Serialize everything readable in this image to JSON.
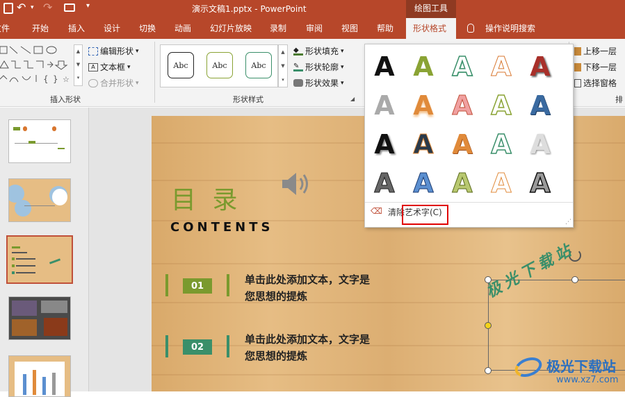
{
  "titlebar": {
    "title": "演示文稿1.pptx - PowerPoint",
    "context_tab": "绘图工具"
  },
  "tabs": [
    "文件",
    "开始",
    "插入",
    "设计",
    "切换",
    "动画",
    "幻灯片放映",
    "录制",
    "审阅",
    "视图",
    "帮助",
    "形状格式"
  ],
  "tell_me": "操作说明搜索",
  "ribbon": {
    "insert_shapes": {
      "edit_shape": "编辑形状",
      "text_box": "文本框",
      "merge_shapes": "合并形状",
      "label": "插入形状"
    },
    "shape_styles": {
      "style_sample": "Abc",
      "fill": "形状填充",
      "outline": "形状轮廓",
      "effects": "形状效果",
      "label": "形状样式"
    },
    "arrange": {
      "bring_forward": "上移一层",
      "send_backward": "下移一层",
      "selection_pane": "选择窗格",
      "label_partial": "排"
    }
  },
  "wordart_gallery": {
    "glyph": "A",
    "clear_label": "清除艺术字(C)"
  },
  "slide": {
    "title": "目 录",
    "subtitle": "CONTENTS",
    "items": [
      {
        "num": "01",
        "line1": "单击此处添加文本，文字是",
        "line2": "您思想的提炼"
      },
      {
        "num": "02",
        "line1": "单击此处添加文本，文字是",
        "line2": "您思想的提炼"
      }
    ],
    "wordart_text": "极光下载站"
  },
  "watermark": {
    "name": "极光下载站",
    "url": "www.xz7.com"
  },
  "colors": {
    "accent": "#b7472a",
    "highlight_box": "#e00000",
    "item1": "#7a9a2e",
    "item2": "#3a8f6a"
  }
}
